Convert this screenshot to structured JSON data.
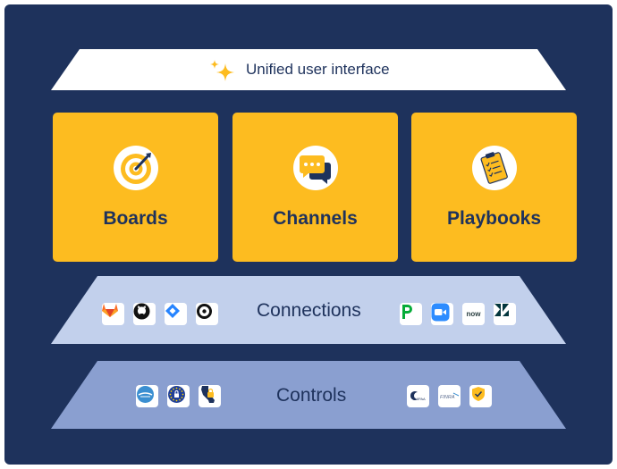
{
  "banner": {
    "label": "Unified user interface",
    "icon": "sparkle-icon"
  },
  "cards": [
    {
      "label": "Boards",
      "icon": "target-icon"
    },
    {
      "label": "Channels",
      "icon": "chat-bubbles-icon"
    },
    {
      "label": "Playbooks",
      "icon": "clipboard-checklist-icon"
    }
  ],
  "connections": {
    "label": "Connections",
    "left_logos": [
      "gitlab-logo",
      "github-logo",
      "jira-logo",
      "opsgenie-logo"
    ],
    "right_logos": [
      "pagerduty-logo",
      "zoom-logo",
      "servicenow-logo",
      "zendesk-logo"
    ],
    "servicenow_text": "now"
  },
  "controls": {
    "label": "Controls",
    "left_logos": [
      "fedramp-logo",
      "eu-gdpr-logo",
      "california-privacy-logo"
    ],
    "right_logos": [
      "hipaa-logo",
      "finra-logo",
      "security-shield-logo"
    ],
    "hipaa_text": "HIPAA",
    "finra_text": "FINRA"
  },
  "colors": {
    "background": "#1e325c",
    "card": "#fdbc20",
    "banner": "#ffffff",
    "connections_layer": "#c2d0ec",
    "controls_layer": "#8a9fd0",
    "text": "#1e325c"
  }
}
